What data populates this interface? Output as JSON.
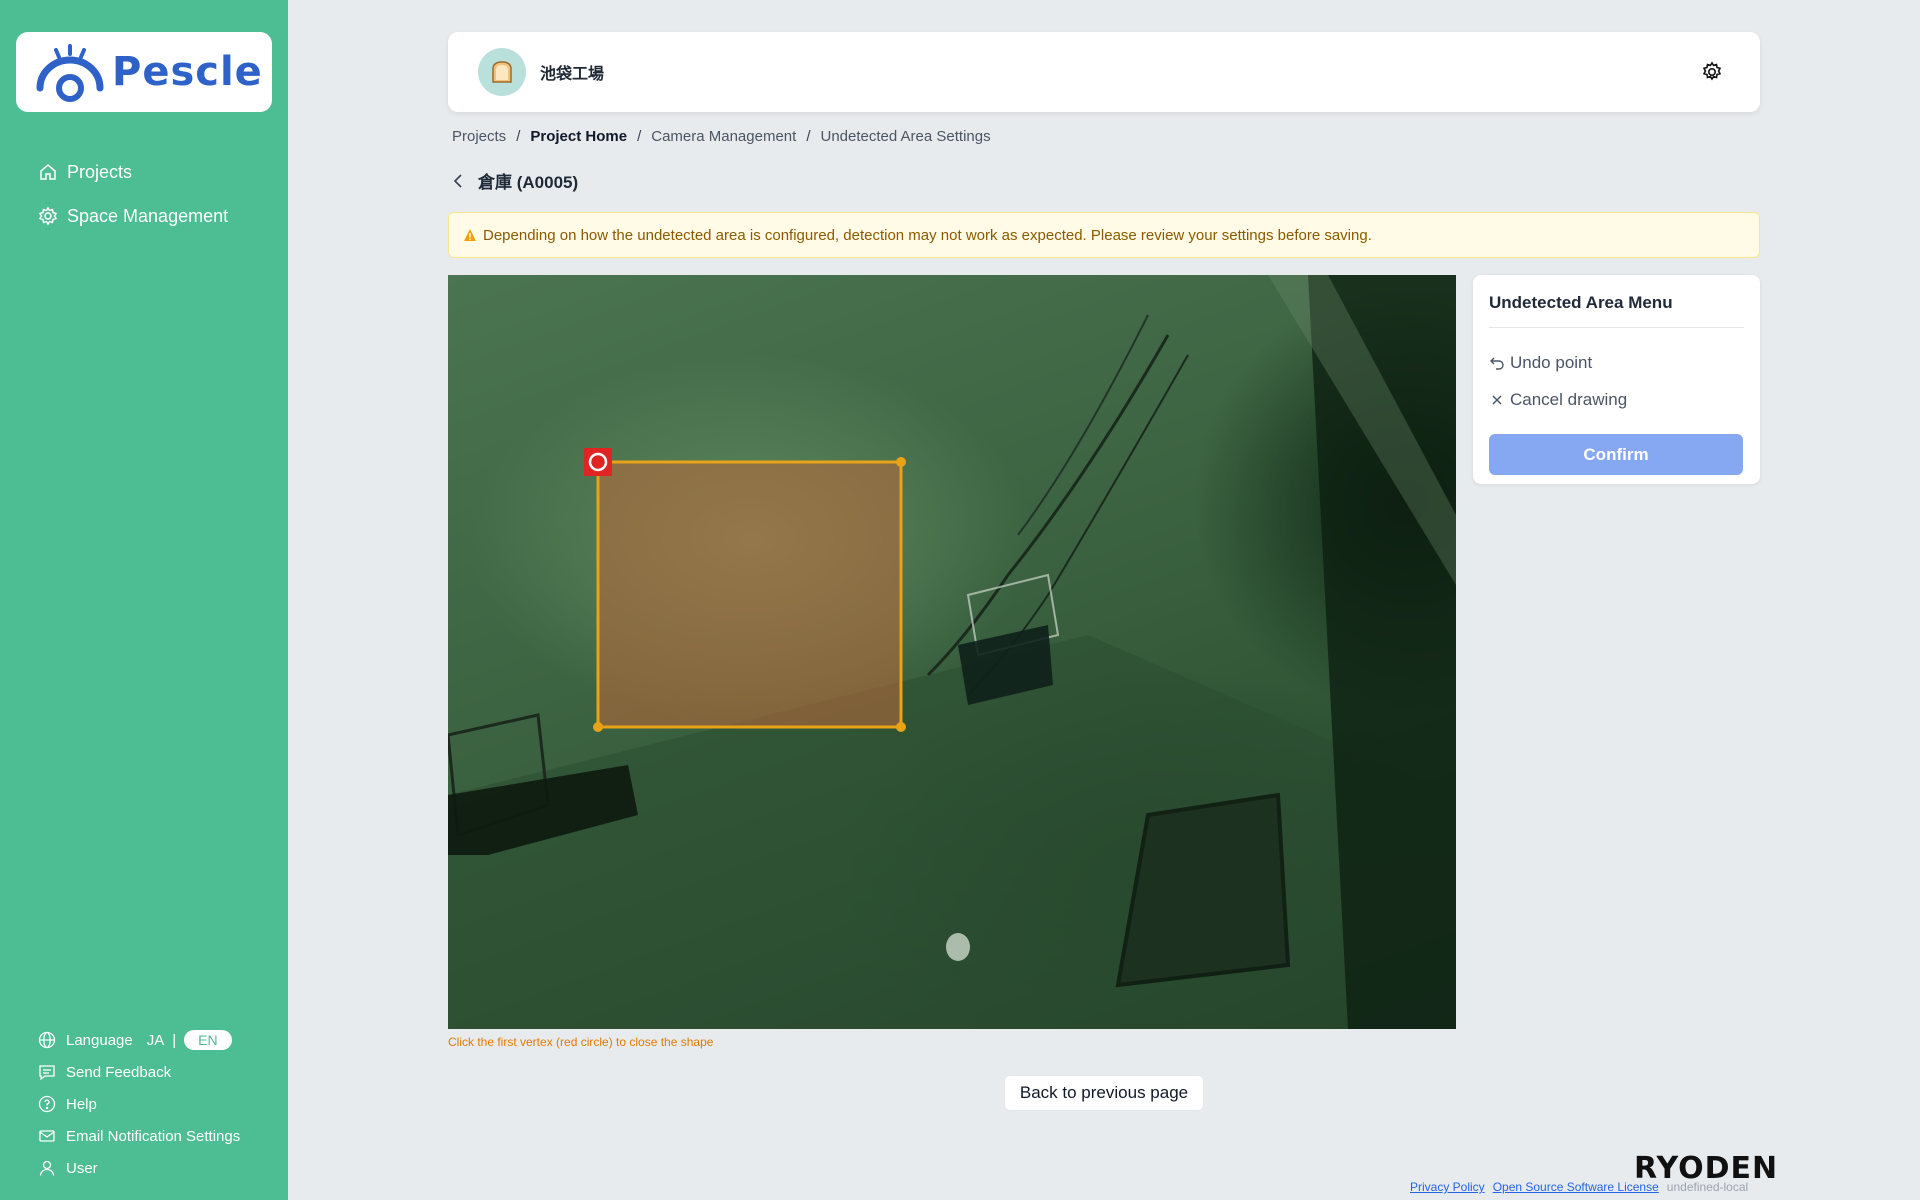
{
  "brand": {
    "logo_text": "Pescle",
    "logo_color": "#2e62c9",
    "sidebar_color": "#4dbd94"
  },
  "sidebar": {
    "items": [
      {
        "label": "Projects",
        "icon": "home-icon"
      },
      {
        "label": "Space Management",
        "icon": "gear-icon"
      }
    ],
    "bottom": {
      "language_label": "Language",
      "lang_ja": "JA",
      "lang_sep": "|",
      "lang_en": "EN",
      "send_feedback": "Send Feedback",
      "help": "Help",
      "email_settings": "Email Notification Settings",
      "user": "User"
    }
  },
  "header": {
    "site_name": "池袋工場",
    "avatar_icon": "bread-icon"
  },
  "breadcrumb": [
    "Projects",
    "Project Home",
    "Camera Management",
    "Undetected Area Settings"
  ],
  "page_title": "倉庫 (A0005)",
  "warning": {
    "text": "Depending on how the undetected area is configured, detection may not work as expected. Please review your settings before saving."
  },
  "camera": {
    "hint": "Click the first vertex (red circle) to close the shape",
    "area_color": "#e8a317",
    "first_vertex_color": "#e02424"
  },
  "menu": {
    "title": "Undetected Area Menu",
    "undo": "Undo point",
    "cancel": "Cancel drawing",
    "confirm": "Confirm",
    "confirm_color": "#86a8f2"
  },
  "back_button": "Back to previous page",
  "footer": {
    "company": "RYODEN",
    "privacy": "Privacy Policy",
    "oss": "Open Source Software License",
    "version": "undefined-local"
  }
}
